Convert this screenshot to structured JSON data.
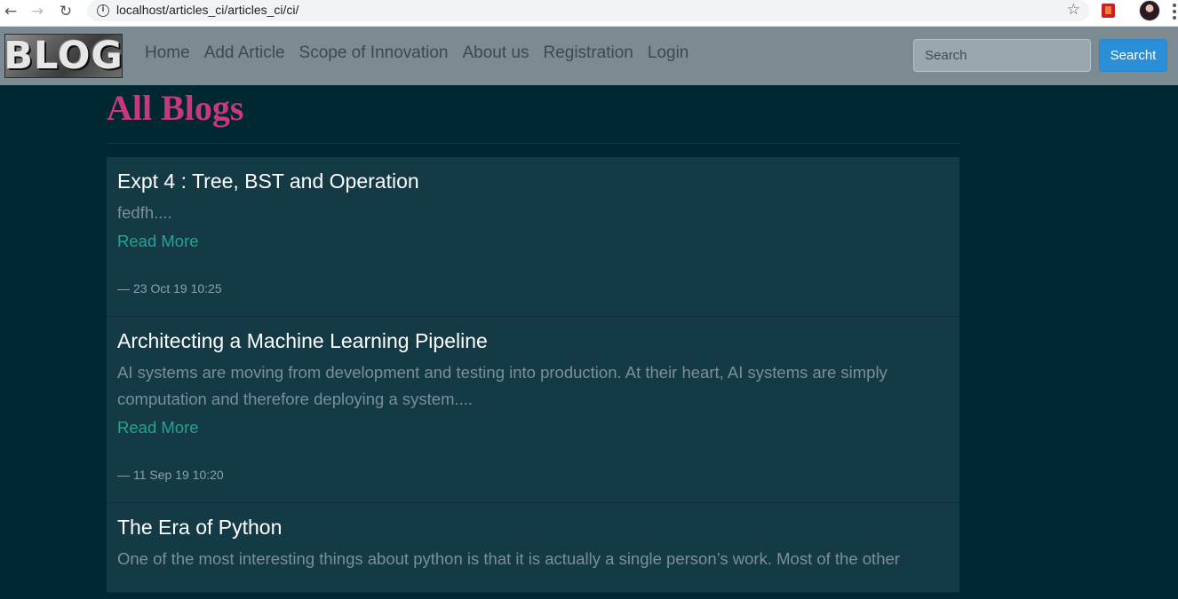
{
  "browser": {
    "url": "localhost/articles_ci/articles_ci/ci/"
  },
  "navbar": {
    "logo_text": "BLOG",
    "links": [
      "Home",
      "Add Article",
      "Scope of Innovation",
      "About us",
      "Registration",
      "Login"
    ],
    "search_placeholder": "Search",
    "search_button": "Searcht"
  },
  "page": {
    "title": "All Blogs"
  },
  "posts": [
    {
      "title": "Expt 4 : Tree, BST and Operation",
      "excerpt": "fedfh....",
      "read_more": "Read More",
      "dash": "—",
      "date": "23 Oct 19 10:25"
    },
    {
      "title": "Architecting a Machine Learning Pipeline",
      "excerpt": "AI systems are moving from development and testing into production. At their heart, AI systems are simply computation and therefore deploying a system....",
      "read_more": "Read More",
      "dash": "—",
      "date": "11 Sep 19 10:20"
    },
    {
      "title": "The Era of Python",
      "excerpt": "One of the most interesting things about python is that it is actually a single person’s work. Most of the other",
      "read_more": "",
      "dash": "",
      "date": ""
    }
  ],
  "colors": {
    "background": "#002833",
    "navbar": "#7b8b91",
    "title_accent": "#c8387e",
    "link": "#2aa198",
    "card": "#133a45",
    "search_button": "#2b8fd8"
  }
}
